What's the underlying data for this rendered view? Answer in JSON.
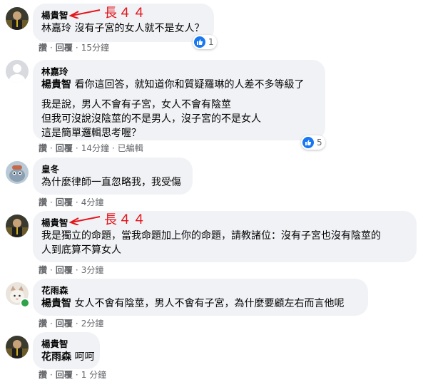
{
  "annotation": {
    "text": "長４４",
    "color": "#e4141b"
  },
  "comments": [
    {
      "author": "楊貴智",
      "lines": [
        "林嘉玲 沒有子宮的女人就不是女人？"
      ],
      "actions": {
        "like": "讚",
        "reply": "回覆",
        "time": "15分鐘"
      },
      "reactions": {
        "count": "1"
      }
    },
    {
      "author": "林嘉玲",
      "mention": "楊貴智",
      "lines": [
        " 看你這回答，就知道你和質疑羅琳的人差不多等級了",
        "我是說，男人不會有子宮，女人不會有陰莖",
        "但我可沒說沒陰莖的不是男人，沒子宮的不是女人",
        "這是簡單邏輯思考喔？"
      ],
      "actions": {
        "like": "讚",
        "reply": "回覆",
        "time": "14分鐘",
        "edited": "已編輯"
      },
      "reactions": {
        "count": "5"
      }
    },
    {
      "author": "皇冬",
      "lines": [
        "為什麼律師一直忽略我，我受傷"
      ],
      "actions": {
        "like": "讚",
        "reply": "回覆",
        "time": "4分鐘"
      }
    },
    {
      "author": "楊貴智",
      "lines": [
        "我是獨立的命題，當我命題加上你的命題，請教諸位：沒有子宮也沒有陰莖的",
        "人到底算不算女人"
      ],
      "actions": {
        "like": "讚",
        "reply": "回覆",
        "time": "3分鐘"
      }
    },
    {
      "author": "花雨森",
      "mention": "楊貴智",
      "lines": [
        " 女人不會有陰莖，男人不會有子宮，為什麼要顧左右而言他呢"
      ],
      "actions": {
        "like": "讚",
        "reply": "回覆",
        "time": "2分鐘"
      }
    },
    {
      "author": "楊貴智",
      "mention": "花雨森",
      "lines": [
        " 呵呵"
      ],
      "actions": {
        "like": "讚",
        "reply": "回覆",
        "time": "1 分鐘"
      }
    }
  ]
}
